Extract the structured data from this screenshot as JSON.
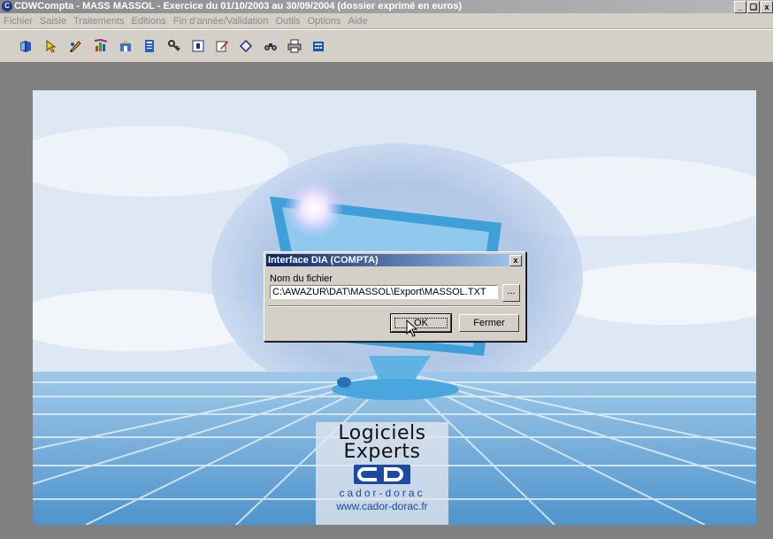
{
  "window": {
    "title": "CDWCompta - MASS MASSOL - Exercice du 01/10/2003 au 30/09/2004 (dossier exprimé en euros)",
    "controls": [
      "_",
      "❑",
      "x"
    ]
  },
  "menubar": {
    "items": [
      "Fichier",
      "Saisie",
      "Traitements",
      "Editions",
      "Fin d'année/Validation",
      "Outils",
      "Options",
      "Aide"
    ]
  },
  "toolbar": {
    "icons": [
      "book-icon",
      "pointer-icon",
      "pen-icon",
      "chart-icon",
      "wizard-icon",
      "ledger-icon",
      "key-icon",
      "form-icon",
      "edit-icon",
      "diamond-icon",
      "binoculars-icon",
      "printer-icon",
      "calculator-icon"
    ]
  },
  "splash": {
    "logo_line1": "Logiciels",
    "logo_line2": "Experts",
    "company": "cador-dorac",
    "url": "www.cador-dorac.fr"
  },
  "dialog": {
    "title": "Interface DIA (COMPTA)",
    "close_label": "x",
    "field_label": "Nom du fichier",
    "file_value": "C:\\AWAZUR\\DAT\\MASSOL\\Export\\MASSOL.TXT",
    "browse_label": "...",
    "ok_label": "OK",
    "close_button_label": "Fermer"
  },
  "colors": {
    "dialog_title_start": "#0a246a",
    "dialog_title_end": "#a6caf0",
    "window_face": "#d4d0c8",
    "logo_blue": "#1c4aa0"
  }
}
